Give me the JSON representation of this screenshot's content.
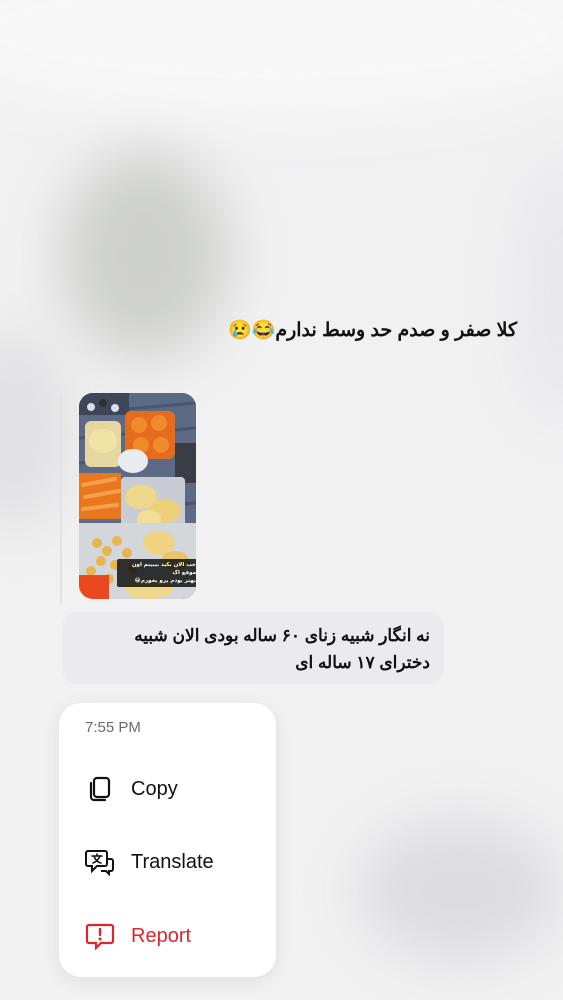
{
  "messages": {
    "top_text": "کلا صفر و صدم حد وسط ندارم",
    "top_emojis": "😂😢",
    "reply": {
      "image_caption_line1": "خب الان بکید بیبینم اون موقع اک",
      "image_caption_line2": "بهتر بودم یرو بخورم😂",
      "image_icon": "food-photo-icon"
    },
    "bubble_line1": "نه انگار شبیه زنای ۶۰ ساله بودی الان شبیه",
    "bubble_line2": "دخترای ۱۷ ساله ای"
  },
  "context_menu": {
    "time": "7:55 PM",
    "items": [
      {
        "label": "Copy",
        "icon": "copy-icon"
      },
      {
        "label": "Translate",
        "icon": "translate-icon"
      },
      {
        "label": "Report",
        "icon": "report-icon",
        "color": "#e0242d"
      }
    ]
  }
}
